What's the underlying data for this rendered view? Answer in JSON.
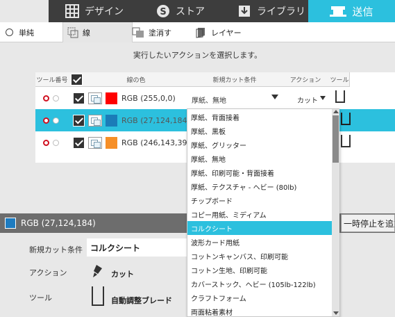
{
  "nav": {
    "tabs": [
      {
        "label": "デザイン",
        "icon": "grid-icon"
      },
      {
        "label": "ストア",
        "icon": "store-s-icon"
      },
      {
        "label": "ライブラリ",
        "icon": "library-download-icon"
      }
    ],
    "active": {
      "label": "送信",
      "icon": "send-cutter-icon"
    }
  },
  "mode_tabs": [
    {
      "label": "単純",
      "icon": "radio-icon"
    },
    {
      "label": "線",
      "icon": "line-icon"
    },
    {
      "label": "塗消す",
      "icon": "fill-icon"
    },
    {
      "label": "レイヤー",
      "icon": "layer-icon"
    }
  ],
  "instruction": "実行したいアクションを選択します。",
  "table": {
    "headers": {
      "tool_no": "ツール番号",
      "line_color": "線の色",
      "condition": "新規カット条件",
      "action": "アクション",
      "tool": "ツール"
    },
    "rows": [
      {
        "rgb": "RGB (255,0,0)",
        "color": "#ff0000",
        "condition": "厚紙、無地",
        "action": "カット",
        "selected": false
      },
      {
        "rgb": "RGB (27,124,184)",
        "color": "#1b7cb8",
        "condition": "",
        "action": "",
        "selected": true
      },
      {
        "rgb": "RGB (246,143,39)",
        "color": "#f68f27",
        "condition": "",
        "action": "",
        "selected": false
      }
    ]
  },
  "dropdown": {
    "options": [
      "厚紙、背面接着",
      "厚紙、黒板",
      "厚紙、グリッター",
      "厚紙、無地",
      "厚紙、印刷可能・背面接着",
      "厚紙、テクスチャ - ヘビー (80lb)",
      "チップボード",
      "コピー用紙、ミディアム",
      "コルクシート",
      "波形カード用紙",
      "コットンキャンバス、印刷可能",
      "コットン生地、印刷可能",
      "カバーストック、ヘビー (105lb-122lb)",
      "クラフトフォーム",
      "両面粘着素材"
    ],
    "highlighted_index": 8
  },
  "selected_panel": {
    "color_text": "RGB (27,124,184)",
    "color": "#1b7cb8",
    "pause_button": "一時停止を追加",
    "condition_label": "新規カット条件",
    "condition_value": "コルクシート",
    "action_label": "アクション",
    "action_value": "カット",
    "tool_label": "ツール",
    "tool_value": "自動調整ブレード"
  },
  "colors": {
    "accent": "#2cc0de",
    "nav_dark": "#3d3d3d"
  }
}
